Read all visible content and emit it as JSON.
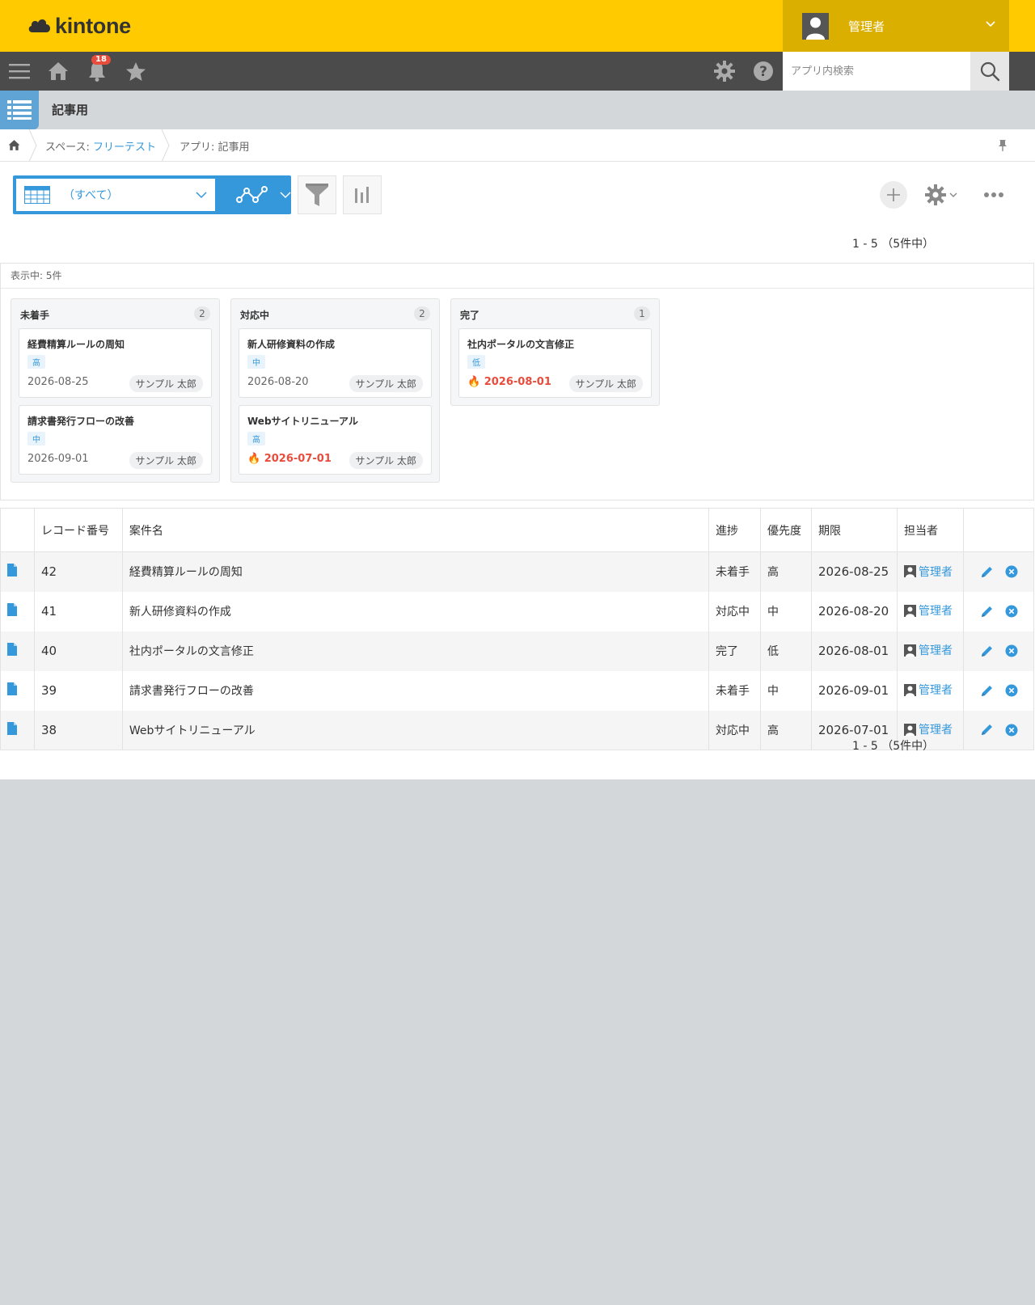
{
  "header": {
    "brand": "kintone",
    "user_name": "管理者",
    "notification_count": "18",
    "search_placeholder": "アプリ内検索"
  },
  "app": {
    "name": "記事用"
  },
  "breadcrumb": {
    "space_prefix": "スペース: ",
    "space_name": "フリーテスト",
    "app_label": "アプリ: 記事用"
  },
  "view": {
    "name": "（すべて）"
  },
  "pagination": {
    "range": "1 - 5",
    "total": "（5件中）"
  },
  "kanban": {
    "count_label": "表示中: 5件",
    "lanes": [
      {
        "title": "未着手",
        "count": "2",
        "cards": [
          {
            "title": "経費精算ルールの周知",
            "priority": "高",
            "due": "2026-08-25",
            "overdue": false,
            "assignee": "サンプル 太郎"
          },
          {
            "title": "請求書発行フローの改善",
            "priority": "中",
            "due": "2026-09-01",
            "overdue": false,
            "assignee": "サンプル 太郎"
          }
        ]
      },
      {
        "title": "対応中",
        "count": "2",
        "cards": [
          {
            "title": "新人研修資料の作成",
            "priority": "中",
            "due": "2026-08-20",
            "overdue": false,
            "assignee": "サンプル 太郎"
          },
          {
            "title": "Webサイトリニューアル",
            "priority": "高",
            "due": "2026-07-01",
            "overdue": true,
            "assignee": "サンプル 太郎"
          }
        ]
      },
      {
        "title": "完了",
        "count": "1",
        "cards": [
          {
            "title": "社内ポータルの文言修正",
            "priority": "低",
            "due": "2026-08-01",
            "overdue": true,
            "assignee": "サンプル 太郎"
          }
        ]
      }
    ]
  },
  "table": {
    "columns": [
      "",
      "レコード番号",
      "案件名",
      "進捗",
      "優先度",
      "期限",
      "担当者",
      ""
    ],
    "rows": [
      {
        "id": "42",
        "name": "経費精算ルールの周知",
        "status": "未着手",
        "priority": "高",
        "due": "2026-08-25",
        "assignee": "管理者"
      },
      {
        "id": "41",
        "name": "新人研修資料の作成",
        "status": "対応中",
        "priority": "中",
        "due": "2026-08-20",
        "assignee": "管理者"
      },
      {
        "id": "40",
        "name": "社内ポータルの文言修正",
        "status": "完了",
        "priority": "低",
        "due": "2026-08-01",
        "assignee": "管理者"
      },
      {
        "id": "39",
        "name": "請求書発行フローの改善",
        "status": "未着手",
        "priority": "中",
        "due": "2026-09-01",
        "assignee": "管理者"
      },
      {
        "id": "38",
        "name": "Webサイトリニューアル",
        "status": "対応中",
        "priority": "高",
        "due": "2026-07-01",
        "assignee": "管理者"
      }
    ]
  },
  "colors": {
    "brand_yellow": "#ffcb00",
    "user_area": "#dbaf00",
    "toolbar": "#4b4b4b",
    "accent_blue": "#3498db",
    "overdue_red": "#e74c3c"
  },
  "icons": {
    "menu": "hamburger-icon",
    "home": "home-icon",
    "notify": "bell-icon",
    "favorite": "star-icon",
    "settings": "gear-icon",
    "help": "help-icon",
    "search": "search-icon",
    "overdue": "fire-icon"
  }
}
